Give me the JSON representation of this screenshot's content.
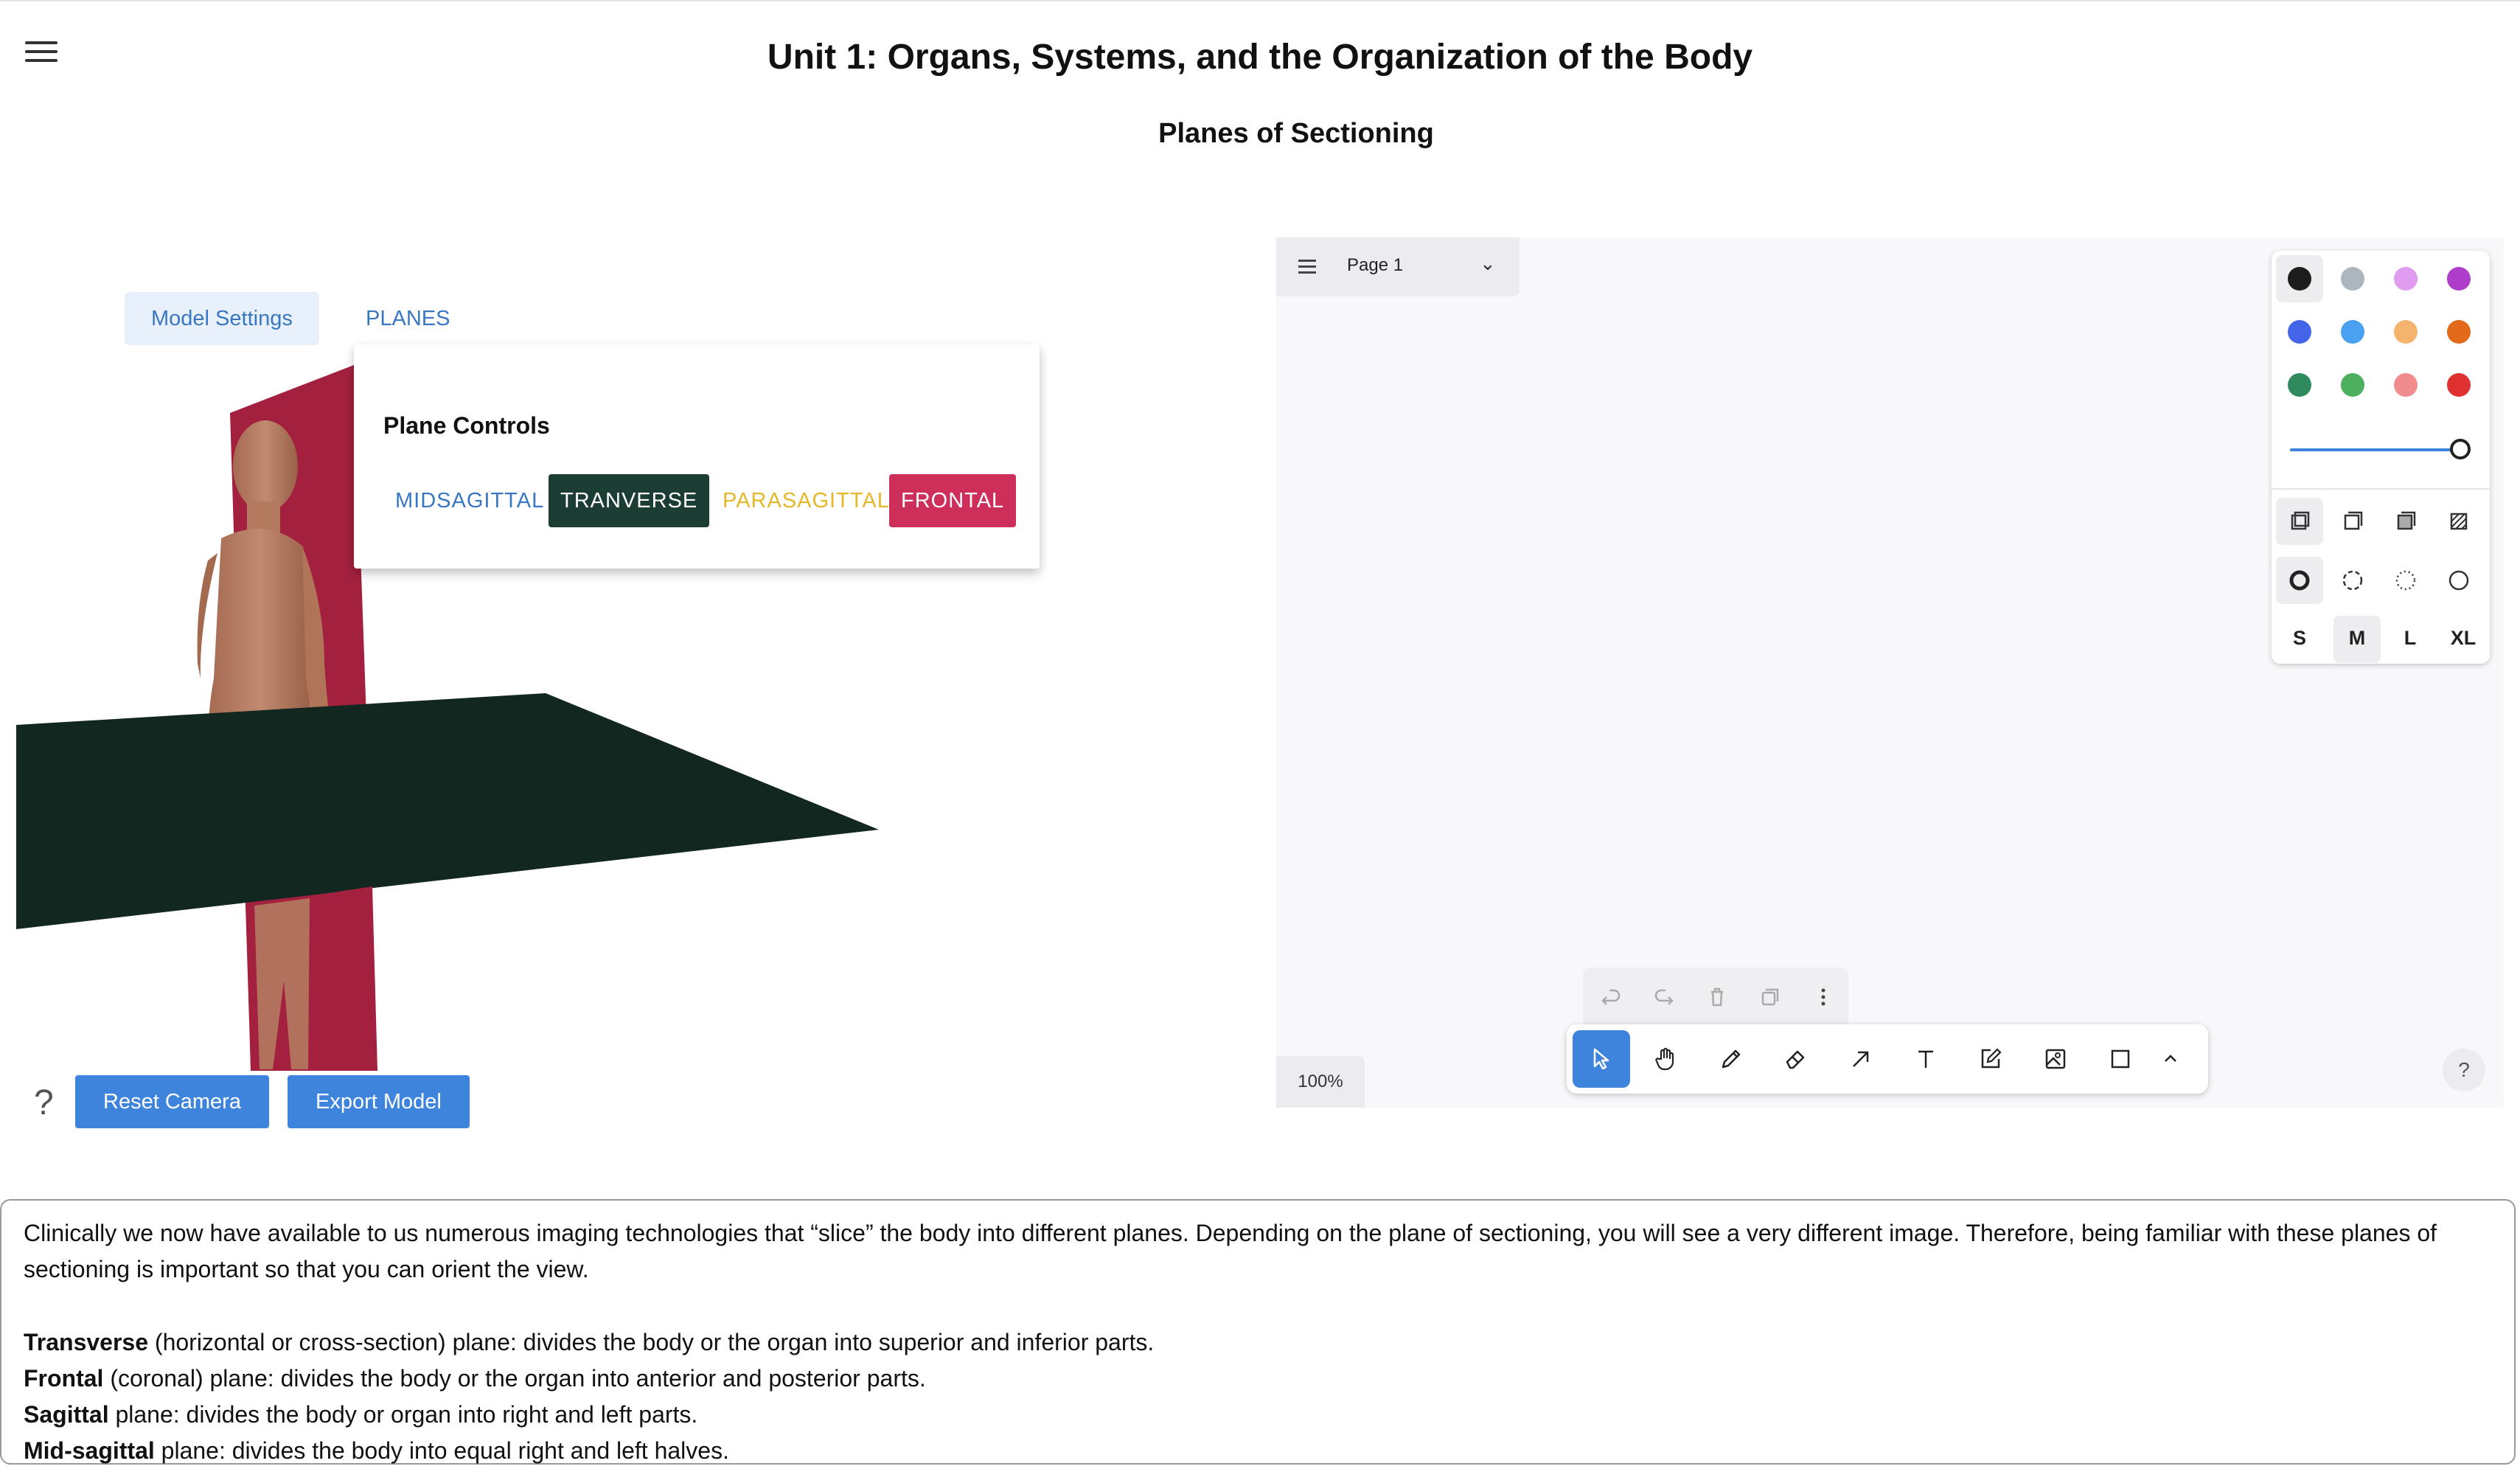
{
  "header": {
    "title": "Unit 1: Organs, Systems, and the Organization of the Body",
    "subtitle": "Planes of Sectioning"
  },
  "viewer": {
    "tabs": [
      {
        "label": "Model Settings",
        "active": true
      },
      {
        "label": "PLANES",
        "active": false
      }
    ],
    "plane_controls": {
      "heading": "Plane Controls",
      "buttons": [
        {
          "label": "MIDSAGITTAL",
          "color": "#3a77c2"
        },
        {
          "label": "TRANVERSE",
          "color": "#1c3d33"
        },
        {
          "label": "PARASAGITTAL",
          "color": "#e6b829"
        },
        {
          "label": "FRONTAL",
          "color": "#cd2e5a"
        }
      ]
    },
    "help": "?",
    "reset_camera": "Reset Camera",
    "export_model": "Export Model"
  },
  "whiteboard": {
    "page_label": "Page 1",
    "zoom": "100%",
    "help": "?",
    "colors": [
      "#1d1d1d",
      "#adb5bd",
      "#e09cf0",
      "#ae3ec9",
      "#4465e9",
      "#4ba1f1",
      "#f5b46d",
      "#e16919",
      "#2f8b5e",
      "#4cb05e",
      "#f08c8e",
      "#e03131"
    ],
    "sizes": [
      "S",
      "M",
      "L",
      "XL"
    ],
    "selected_size": "M",
    "opacity_value": 1.0,
    "tools": [
      "select",
      "hand",
      "draw",
      "eraser",
      "arrow",
      "text",
      "note",
      "asset",
      "rectangle",
      "more"
    ],
    "active_tool": "select",
    "accent": "#3f84dc"
  },
  "content": {
    "intro": "Clinically we now have available to us numerous imaging technologies that “slice” the body into different planes. Depending on the plane of sectioning, you will see a very different image. Therefore, being familiar with these planes of sectioning is important so that you can orient the view.",
    "definitions": [
      {
        "term": "Transverse",
        "text": " (horizontal or cross-section) plane: divides the body or the organ into superior and inferior parts."
      },
      {
        "term": "Frontal",
        "text": " (coronal) plane: divides the body or the organ into anterior and posterior parts."
      },
      {
        "term": "Sagittal",
        "text": " plane: divides the body or organ into right and left parts."
      },
      {
        "term": "Mid-sagittal",
        "text": " plane: divides the body into equal right and left halves."
      }
    ]
  }
}
